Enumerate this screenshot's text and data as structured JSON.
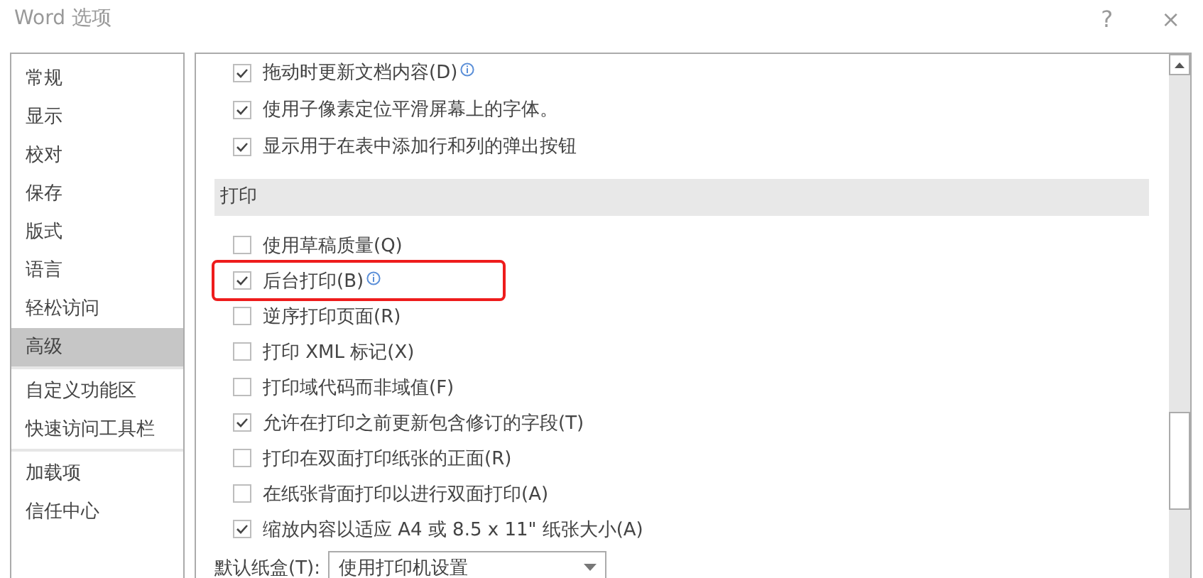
{
  "window": {
    "title": "Word 选项",
    "help": "?",
    "close": "×"
  },
  "sidebar": {
    "items": [
      {
        "label": "常规",
        "selected": false,
        "divider_after": false
      },
      {
        "label": "显示",
        "selected": false,
        "divider_after": false
      },
      {
        "label": "校对",
        "selected": false,
        "divider_after": false
      },
      {
        "label": "保存",
        "selected": false,
        "divider_after": false
      },
      {
        "label": "版式",
        "selected": false,
        "divider_after": false
      },
      {
        "label": "语言",
        "selected": false,
        "divider_after": false
      },
      {
        "label": "轻松访问",
        "selected": false,
        "divider_after": false
      },
      {
        "label": "高级",
        "selected": true,
        "divider_after": true
      },
      {
        "label": "自定义功能区",
        "selected": false,
        "divider_after": false
      },
      {
        "label": "快速访问工具栏",
        "selected": false,
        "divider_after": true
      },
      {
        "label": "加载项",
        "selected": false,
        "divider_after": false
      },
      {
        "label": "信任中心",
        "selected": false,
        "divider_after": false
      }
    ]
  },
  "top_options": [
    {
      "label": "拖动时更新文档内容(D)",
      "checked": true,
      "info": true,
      "highlighted": false
    },
    {
      "label": "使用子像素定位平滑屏幕上的字体。",
      "checked": true,
      "info": false,
      "highlighted": false
    },
    {
      "label": "显示用于在表中添加行和列的弹出按钮",
      "checked": true,
      "info": false,
      "highlighted": false
    }
  ],
  "section": {
    "title": "打印"
  },
  "print_options": [
    {
      "label": "使用草稿质量(Q)",
      "checked": false,
      "info": false,
      "highlighted": false
    },
    {
      "label": "后台打印(B)",
      "checked": true,
      "info": true,
      "highlighted": true
    },
    {
      "label": "逆序打印页面(R)",
      "checked": false,
      "info": false,
      "highlighted": false
    },
    {
      "label": "打印 XML 标记(X)",
      "checked": false,
      "info": false,
      "highlighted": false
    },
    {
      "label": "打印域代码而非域值(F)",
      "checked": false,
      "info": false,
      "highlighted": false
    },
    {
      "label": "允许在打印之前更新包含修订的字段(T)",
      "checked": true,
      "info": false,
      "highlighted": false
    },
    {
      "label": "打印在双面打印纸张的正面(R)",
      "checked": false,
      "info": false,
      "highlighted": false
    },
    {
      "label": "在纸张背面打印以进行双面打印(A)",
      "checked": false,
      "info": false,
      "highlighted": false
    },
    {
      "label": "缩放内容以适应 A4 或 8.5 x 11\" 纸张大小(A)",
      "checked": true,
      "info": false,
      "highlighted": false
    }
  ],
  "tray": {
    "label": "默认纸盒(T):",
    "value": "使用打印机设置"
  }
}
